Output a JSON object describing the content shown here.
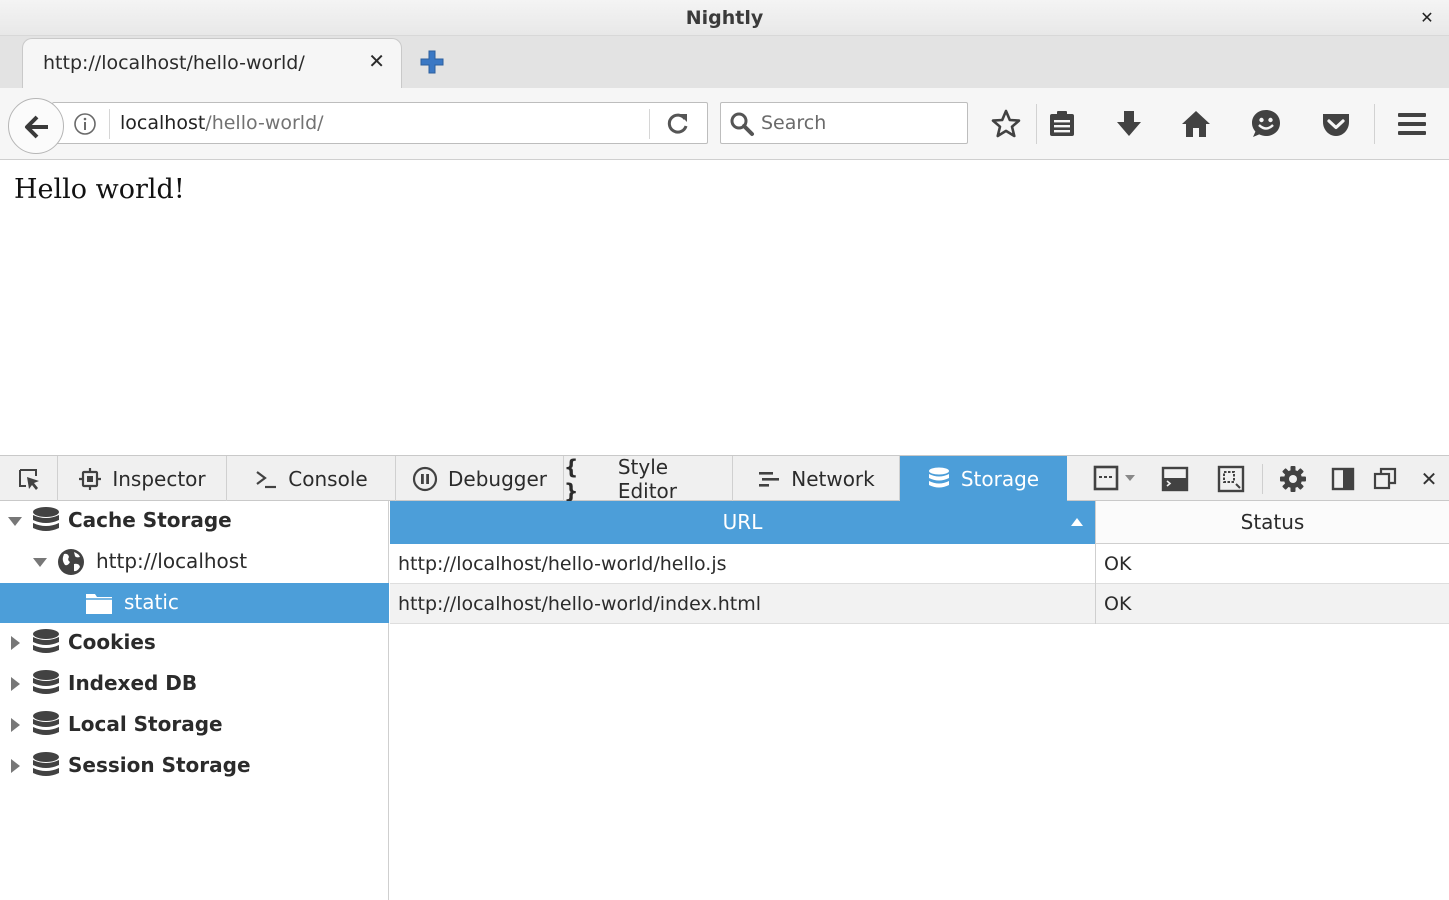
{
  "window": {
    "title": "Nightly"
  },
  "tabs": [
    {
      "label": "http://localhost/hello-world/"
    }
  ],
  "navbar": {
    "url_host": "localhost",
    "url_path": "/hello-world/",
    "search_placeholder": "Search"
  },
  "page": {
    "text": "Hello world!"
  },
  "devtools": {
    "tabs": [
      {
        "label": "Inspector",
        "icon": "inspector-icon"
      },
      {
        "label": "Console",
        "icon": "console-icon"
      },
      {
        "label": "Debugger",
        "icon": "debugger-icon"
      },
      {
        "label": "Style Editor",
        "icon": "style-editor-icon"
      },
      {
        "label": "Network",
        "icon": "network-icon"
      },
      {
        "label": "Storage",
        "icon": "storage-icon",
        "selected": true
      }
    ]
  },
  "storage_tree": {
    "items": [
      {
        "label": "Cache Storage",
        "level": 0,
        "expanded": true
      },
      {
        "label": "http://localhost",
        "level": 1,
        "expanded": true
      },
      {
        "label": "static",
        "level": 2,
        "selected": true
      },
      {
        "label": "Cookies",
        "level": 0,
        "expanded": false
      },
      {
        "label": "Indexed DB",
        "level": 0,
        "expanded": false
      },
      {
        "label": "Local Storage",
        "level": 0,
        "expanded": false
      },
      {
        "label": "Session Storage",
        "level": 0,
        "expanded": false
      }
    ]
  },
  "table": {
    "columns": [
      {
        "label": "URL",
        "sorted": "ascending"
      },
      {
        "label": "Status"
      }
    ],
    "rows": [
      {
        "url": "http://localhost/hello-world/hello.js",
        "status": "OK"
      },
      {
        "url": "http://localhost/hello-world/index.html",
        "status": "OK"
      }
    ]
  },
  "colors": {
    "accent": "#4c9ed9",
    "toolbar": "#f6f6f6",
    "icon": "#424242"
  }
}
